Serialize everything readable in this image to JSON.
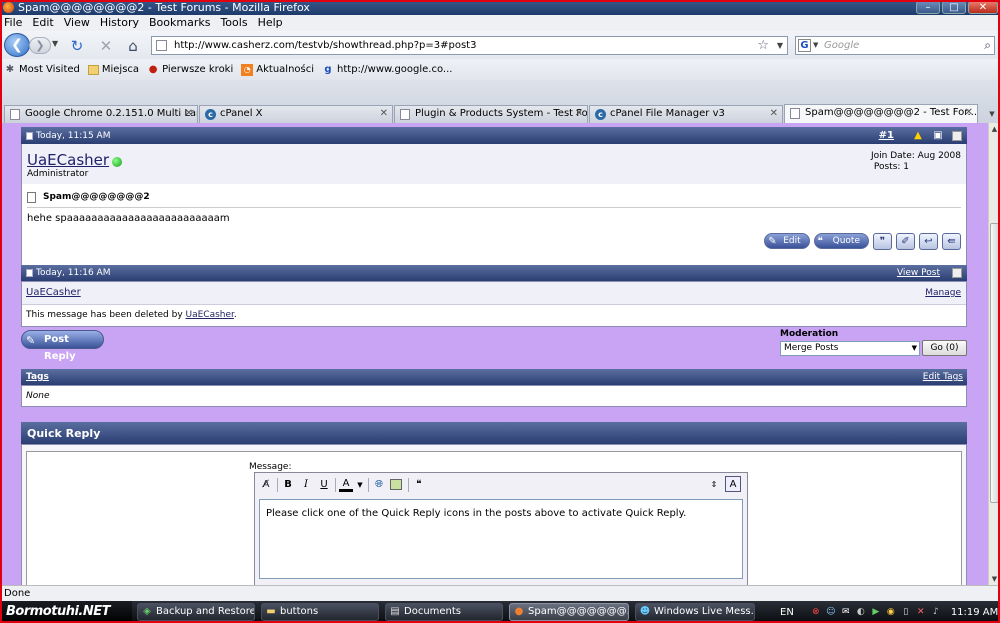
{
  "window": {
    "title": "Spam@@@@@@@@2 - Test Forums - Mozilla Firefox",
    "minimize": "–",
    "maximize": "□",
    "close": "✕"
  },
  "menu": [
    "File",
    "Edit",
    "View",
    "History",
    "Bookmarks",
    "Tools",
    "Help"
  ],
  "nav": {
    "url": "http://www.casherz.com/testvb/showthread.php?p=3#post3",
    "search_placeholder": "Google",
    "search_engine_letter": "G"
  },
  "bookmarks": [
    {
      "label": "Most Visited",
      "icon": "gear-icon"
    },
    {
      "label": "Miejsca",
      "icon": "folder-icon"
    },
    {
      "label": "Pierwsze kroki",
      "icon": "firefox-icon"
    },
    {
      "label": "Aktualności",
      "icon": "rss-icon"
    },
    {
      "label": "http://www.google.co...",
      "icon": "google-icon"
    }
  ],
  "tabs": [
    {
      "label": "Google Chrome 0.2.151.0 Multi Lan...",
      "icon": "page-icon",
      "active": false
    },
    {
      "label": "cPanel X",
      "icon": "cpanel-icon",
      "active": false
    },
    {
      "label": "Plugin & Products System - Test Fo...",
      "icon": "page-icon",
      "active": false
    },
    {
      "label": "cPanel File Manager v3",
      "icon": "cpanel-icon",
      "active": false
    },
    {
      "label": "Spam@@@@@@@@2 - Test For...",
      "icon": "page-icon",
      "active": true
    }
  ],
  "post1": {
    "date": "Today, 11:15 AM",
    "number": "#1",
    "username": "UaECasher",
    "role": "Administrator",
    "join_date": "Join Date: Aug 2008",
    "posts": "Posts: 1",
    "title": "Spam@@@@@@@@2",
    "message": "hehe spaaaaaaaaaaaaaaaaaaaaaaaaam",
    "edit_label": "Edit",
    "quote_label": "Quote"
  },
  "post2": {
    "date": "Today, 11:16 AM",
    "view_post": "View Post",
    "username": "UaECasher",
    "manage": "Manage",
    "message_prefix": "This message has been deleted by ",
    "message_user": "UaECasher",
    "message_suffix": "."
  },
  "thread_actions": {
    "post_reply": "Post Reply",
    "moderation_label": "Moderation",
    "moderation_selected": "Merge Posts",
    "go_button": "Go (0)"
  },
  "tags": {
    "header": "Tags",
    "edit": "Edit Tags",
    "value": "None"
  },
  "quick_reply": {
    "header": "Quick Reply",
    "message_label": "Message:",
    "textarea_text": "Please click one of the Quick Reply icons in the posts above to activate Quick Reply."
  },
  "status": {
    "text": "Done"
  },
  "taskbar": {
    "start": "Bormotuhi.NET",
    "tasks": [
      {
        "label": "Backup and Restore ...",
        "active": false
      },
      {
        "label": "buttons",
        "active": false
      },
      {
        "label": "Documents",
        "active": false
      },
      {
        "label": "Spam@@@@@@@...",
        "active": true
      },
      {
        "label": "Windows Live Mess...",
        "active": false
      }
    ],
    "lang": "EN",
    "clock": "11:19 AM"
  },
  "colors": {
    "page_background": "#c9a4f4",
    "thread_header": "#2a3e72",
    "frame_red": "#e00010"
  }
}
